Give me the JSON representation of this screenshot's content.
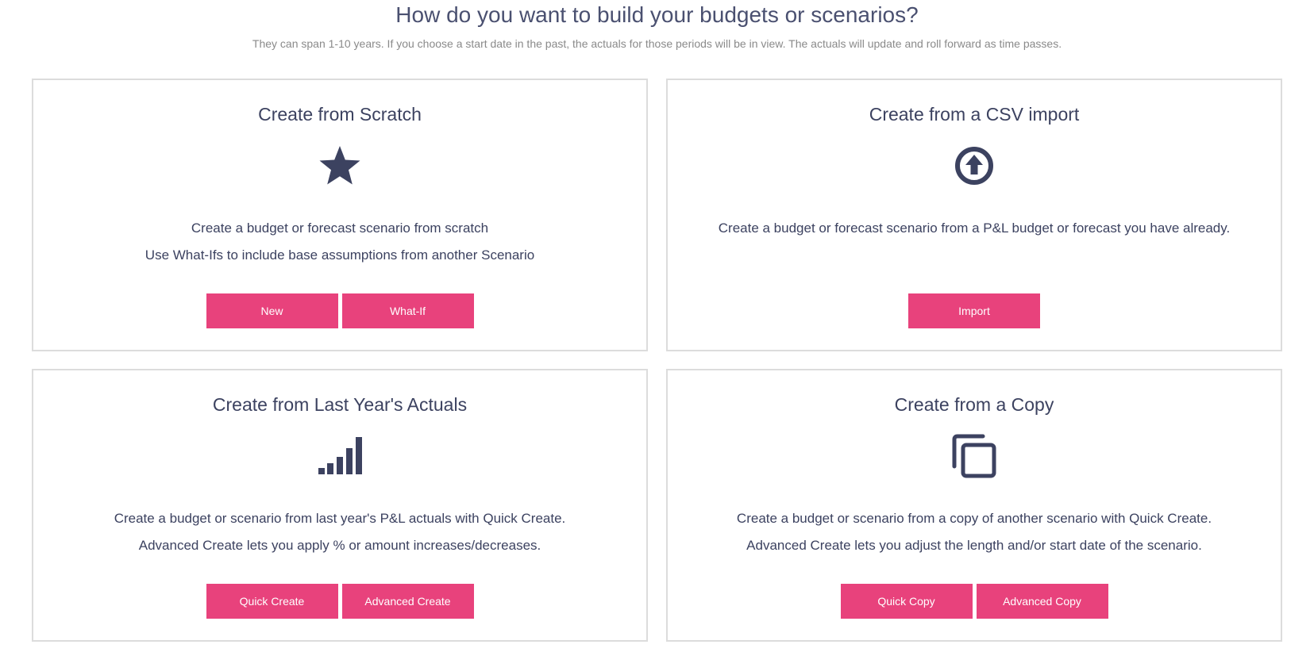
{
  "header": {
    "title": "How do you want to build your budgets or scenarios?",
    "subtitle": "They can span 1-10 years. If you choose a start date in the past, the actuals for those periods will be in view. The actuals will update and roll forward as time passes."
  },
  "colors": {
    "accent": "#e8427c",
    "text": "#3c4260",
    "border": "#dcdcdc"
  },
  "cards": {
    "scratch": {
      "title": "Create from Scratch",
      "icon": "star-icon",
      "lines": [
        "Create a budget or forecast scenario from scratch",
        "Use What-Ifs to include base assumptions from another Scenario"
      ],
      "buttons": [
        "New",
        "What-If"
      ]
    },
    "csv": {
      "title": "Create from a CSV import",
      "icon": "upload-circle-icon",
      "lines": [
        "Create a budget or forecast scenario from a P&L budget or forecast you have already."
      ],
      "buttons": [
        "Import"
      ]
    },
    "actuals": {
      "title": "Create from Last Year's Actuals",
      "icon": "bar-chart-icon",
      "lines": [
        "Create a budget or scenario from last year's P&L actuals with Quick Create.",
        "Advanced Create lets you apply % or amount increases/decreases."
      ],
      "buttons": [
        "Quick Create",
        "Advanced Create"
      ]
    },
    "copy": {
      "title": "Create from a Copy",
      "icon": "copy-icon",
      "lines": [
        "Create a budget or scenario from a copy of another scenario with Quick Create.",
        "Advanced Create lets you adjust the length and/or start date of the scenario."
      ],
      "buttons": [
        "Quick Copy",
        "Advanced Copy"
      ]
    }
  }
}
